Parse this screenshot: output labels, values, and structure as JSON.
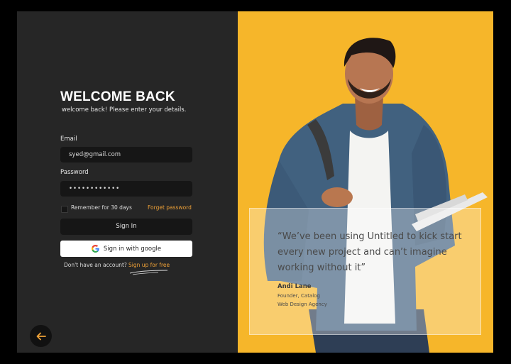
{
  "login": {
    "title": "WELCOME BACK",
    "subtitle": "welcome back! Please enter your details.",
    "email_label": "Email",
    "email_value": "syed@gmail.com",
    "password_label": "Password",
    "password_value": "••••••••••••",
    "remember_label": "Remember for 30 days",
    "forgot_label": "Forget password",
    "signin_label": "Sign In",
    "google_label": "Sign in with google",
    "no_account_text": "Don't have an account?",
    "signup_label": "Sign up for free",
    "accent_color": "#f0a237"
  },
  "testimonial": {
    "quote": "“We’ve been using Untitled to kick start every new project and can’t imagine working without it”",
    "author": "Andi Lane",
    "role": "Founder, Catalog",
    "company": "Web Design Agency"
  },
  "icons": {
    "back": "arrow-left-icon",
    "google": "google-logo-icon"
  },
  "colors": {
    "panel_dark": "#262626",
    "input_bg": "#161616",
    "hero_bg": "#f6b62a"
  }
}
